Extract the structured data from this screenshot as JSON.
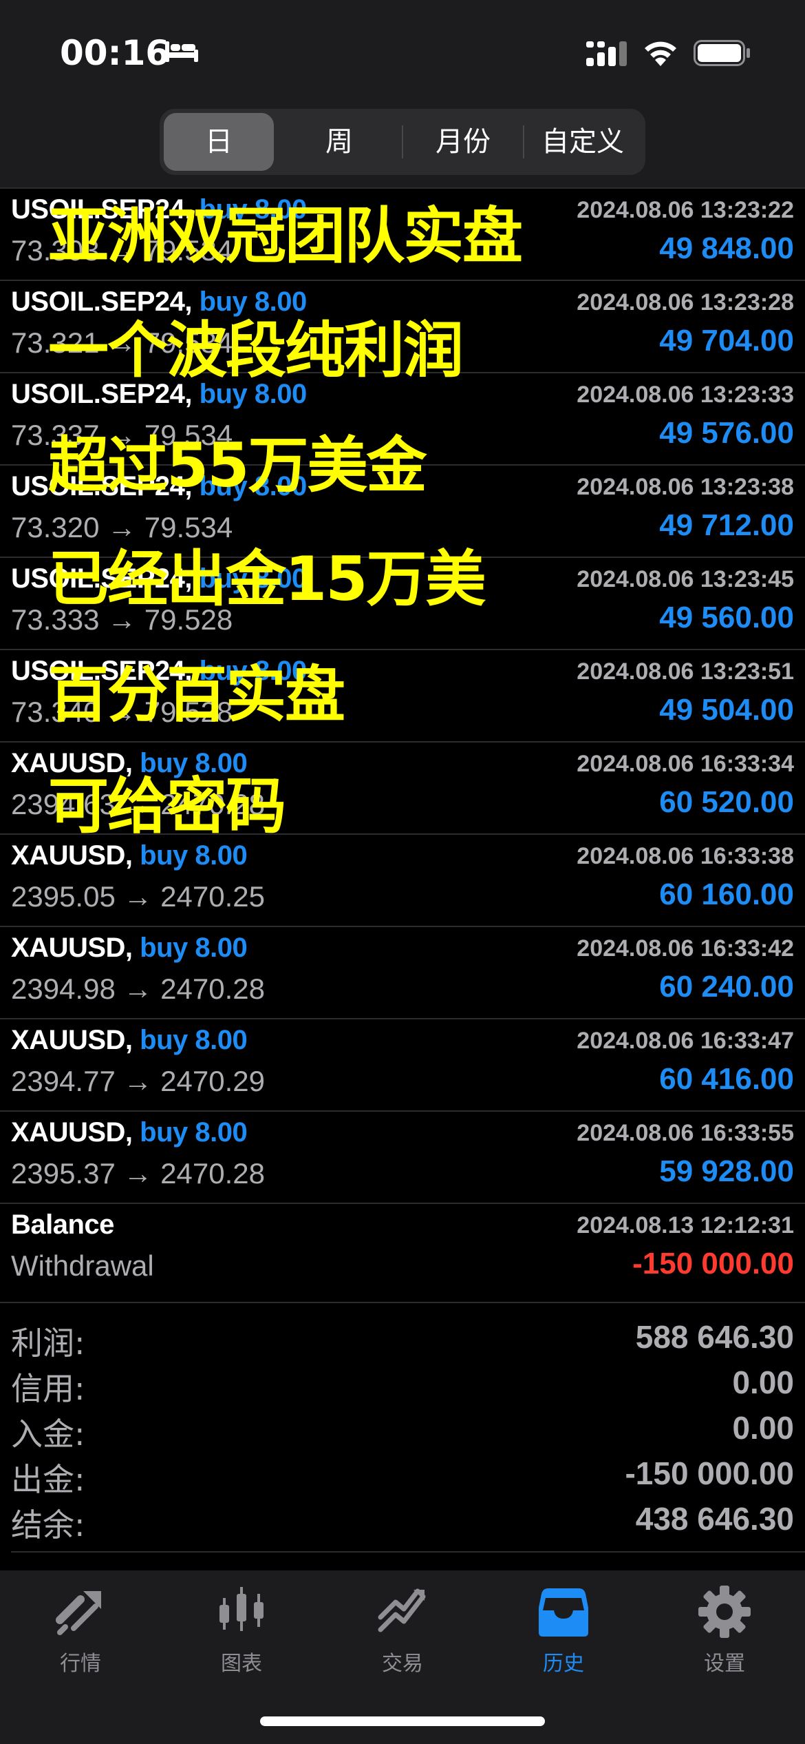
{
  "status_bar": {
    "time": "00:16"
  },
  "segments": [
    {
      "label": "日",
      "active": true
    },
    {
      "label": "周",
      "active": false
    },
    {
      "label": "月份",
      "active": false
    },
    {
      "label": "自定义",
      "active": false
    }
  ],
  "deals": [
    {
      "symbol": "USOIL.SEP24,",
      "side": "buy 8.00",
      "price": "73.303 → 79.534",
      "time": "2024.08.06 13:23:22",
      "profit": "49 848.00"
    },
    {
      "symbol": "USOIL.SEP24,",
      "side": "buy 8.00",
      "price": "73.321 → 79.534",
      "time": "2024.08.06 13:23:28",
      "profit": "49 704.00"
    },
    {
      "symbol": "USOIL.SEP24,",
      "side": "buy 8.00",
      "price": "73.337 → 79.534",
      "time": "2024.08.06 13:23:33",
      "profit": "49 576.00"
    },
    {
      "symbol": "USOIL.SEP24,",
      "side": "buy 8.00",
      "price": "73.320 → 79.534",
      "time": "2024.08.06 13:23:38",
      "profit": "49 712.00"
    },
    {
      "symbol": "USOIL.SEP24,",
      "side": "buy 8.00",
      "price": "73.333 → 79.528",
      "time": "2024.08.06 13:23:45",
      "profit": "49 560.00"
    },
    {
      "symbol": "USOIL.SEP24,",
      "side": "buy 8.00",
      "price": "73.340 → 79.528",
      "time": "2024.08.06 13:23:51",
      "profit": "49 504.00"
    },
    {
      "symbol": "XAUUSD,",
      "side": "buy 8.00",
      "price": "2394.63 → 2470.28",
      "time": "2024.08.06 16:33:34",
      "profit": "60 520.00"
    },
    {
      "symbol": "XAUUSD,",
      "side": "buy 8.00",
      "price": "2395.05 → 2470.25",
      "time": "2024.08.06 16:33:38",
      "profit": "60 160.00"
    },
    {
      "symbol": "XAUUSD,",
      "side": "buy 8.00",
      "price": "2394.98 → 2470.28",
      "time": "2024.08.06 16:33:42",
      "profit": "60 240.00"
    },
    {
      "symbol": "XAUUSD,",
      "side": "buy 8.00",
      "price": "2394.77 → 2470.29",
      "time": "2024.08.06 16:33:47",
      "profit": "60 416.00"
    },
    {
      "symbol": "XAUUSD,",
      "side": "buy 8.00",
      "price": "2395.37 → 2470.28",
      "time": "2024.08.06 16:33:55",
      "profit": "59 928.00"
    }
  ],
  "balance": {
    "symbol": "Balance",
    "price": "Withdrawal",
    "time": "2024.08.13 12:12:31",
    "profit": "-150 000.00"
  },
  "summary": [
    {
      "label": "利润:",
      "value": "588 646.30"
    },
    {
      "label": "信用:",
      "value": "0.00"
    },
    {
      "label": "入金:",
      "value": "0.00"
    },
    {
      "label": "出金:",
      "value": "-150 000.00"
    },
    {
      "label": "结余:",
      "value": "438 646.30"
    }
  ],
  "tabs": [
    {
      "label": "行情",
      "icon": "quotes-icon",
      "active": false
    },
    {
      "label": "图表",
      "icon": "chart-candles-icon",
      "active": false
    },
    {
      "label": "交易",
      "icon": "trade-icon",
      "active": false
    },
    {
      "label": "历史",
      "icon": "history-inbox-icon",
      "active": true
    },
    {
      "label": "设置",
      "icon": "settings-gear-icon",
      "active": false
    }
  ],
  "overlay_text": [
    "亚洲双冠团队实盘",
    "一个波段纯利润",
    "超过55万美金",
    "已经出金15万美",
    "百分百实盘",
    "可给密码"
  ],
  "colors": {
    "accent": "#1e8cf5",
    "negative": "#ff3b30",
    "overlay": "#ffff00"
  }
}
